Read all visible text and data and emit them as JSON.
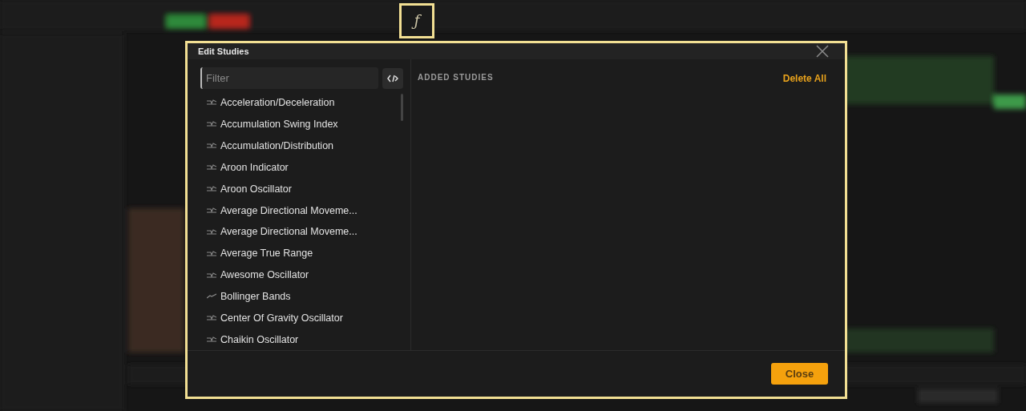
{
  "toolbar": {
    "highlighted_icon": "ƒ"
  },
  "dialog": {
    "title": "Edit Studies",
    "filter": {
      "placeholder": "Filter"
    },
    "studies": [
      {
        "label": "Acceleration/Deceleration",
        "kind": "pane"
      },
      {
        "label": "Accumulation Swing Index",
        "kind": "pane"
      },
      {
        "label": "Accumulation/Distribution",
        "kind": "pane"
      },
      {
        "label": "Aroon Indicator",
        "kind": "pane"
      },
      {
        "label": "Aroon Oscillator",
        "kind": "pane"
      },
      {
        "label": "Average Directional Moveme...",
        "kind": "pane"
      },
      {
        "label": "Average Directional Moveme...",
        "kind": "pane"
      },
      {
        "label": "Average True Range",
        "kind": "pane"
      },
      {
        "label": "Awesome Oscillator",
        "kind": "pane"
      },
      {
        "label": "Bollinger Bands",
        "kind": "overlay"
      },
      {
        "label": "Center Of Gravity Oscillator",
        "kind": "pane"
      },
      {
        "label": "Chaikin Oscillator",
        "kind": "pane"
      }
    ],
    "added_heading": "ADDED STUDIES",
    "delete_all": "Delete All",
    "close_button": "Close"
  }
}
